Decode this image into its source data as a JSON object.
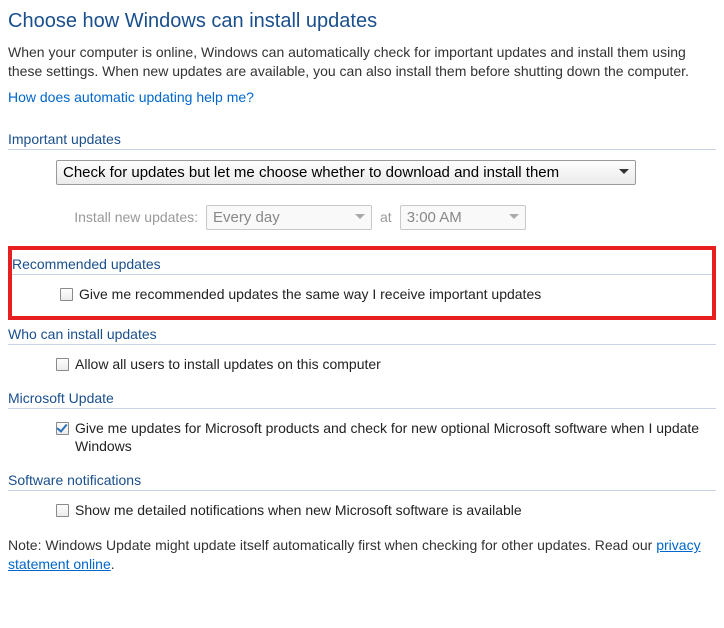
{
  "title": "Choose how Windows can install updates",
  "description": "When your computer is online, Windows can automatically check for important updates and install them using these settings. When new updates are available, you can also install them before shutting down the computer.",
  "helpLink": "How does automatic updating help me?",
  "importantUpdates": {
    "header": "Important updates",
    "mainDropdown": "Check for updates but let me choose whether to download and install them",
    "scheduleLabel": "Install new updates:",
    "frequency": "Every day",
    "atLabel": "at",
    "time": "3:00 AM"
  },
  "recommended": {
    "header": "Recommended updates",
    "checkboxLabel": "Give me recommended updates the same way I receive important updates"
  },
  "whoCanInstall": {
    "header": "Who can install updates",
    "checkboxLabel": "Allow all users to install updates on this computer"
  },
  "microsoftUpdate": {
    "header": "Microsoft Update",
    "checkboxLabel": "Give me updates for Microsoft products and check for new optional Microsoft software when I update Windows"
  },
  "softwareNotifications": {
    "header": "Software notifications",
    "checkboxLabel": "Show me detailed notifications when new Microsoft software is available"
  },
  "note": {
    "prefix": "Note: Windows Update might update itself automatically first when checking for other updates.  Read our ",
    "linkText": "privacy statement online",
    "suffix": "."
  }
}
